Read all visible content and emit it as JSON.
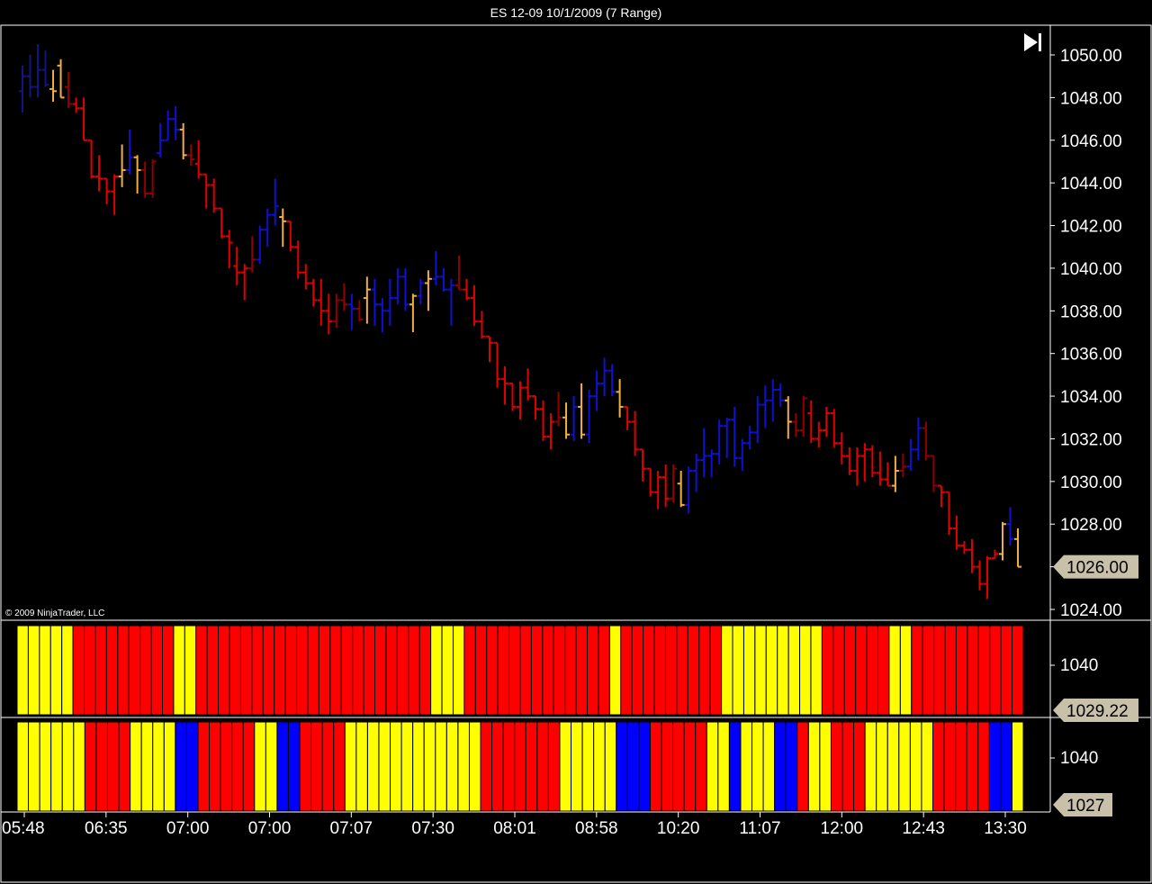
{
  "window": {
    "title": "ES 12-09  10/1/2009 (7 Range)"
  },
  "copyright": "© 2009 NinjaTrader, LLC",
  "icons": {
    "jump_to_end": "skip-to-end-icon"
  },
  "colors": {
    "background": "#000000",
    "up_bar": "#1010d0",
    "dark_up_bar": "#151580",
    "down_bar": "#e00000",
    "dark_down_bar": "#900000",
    "neutral_bar": "#f0b040",
    "histogram_yellow": "#ffff00",
    "histogram_red": "#ff0000",
    "histogram_blue": "#0000ff",
    "price_tag": "#c8c0a8"
  },
  "chart_data": [
    {
      "type": "ohlc",
      "panel": "price",
      "ylim": [
        1023.6,
        1051.2
      ],
      "y_ticks": [
        "1050.00",
        "1048.00",
        "1046.00",
        "1044.00",
        "1042.00",
        "1040.00",
        "1038.00",
        "1036.00",
        "1034.00",
        "1032.00",
        "1030.00",
        "1028.00",
        "1026.00",
        "1024.00"
      ],
      "y_tick_values": [
        1050,
        1048,
        1046,
        1044,
        1042,
        1040,
        1038,
        1036,
        1034,
        1032,
        1030,
        1028,
        1026,
        1024
      ],
      "last_price_label": "1026.00",
      "last_price": 1026.0,
      "bars": [
        {
          "o": 1048.3,
          "h": 1049.5,
          "l": 1047.3,
          "c": 1049.0,
          "col": "b"
        },
        {
          "o": 1049.0,
          "h": 1050.0,
          "l": 1048.0,
          "c": 1048.5,
          "col": "b"
        },
        {
          "o": 1048.5,
          "h": 1050.5,
          "l": 1048.0,
          "c": 1049.3,
          "col": "b"
        },
        {
          "o": 1049.3,
          "h": 1050.2,
          "l": 1048.5,
          "c": 1048.6,
          "col": "b"
        },
        {
          "o": 1048.4,
          "h": 1049.3,
          "l": 1047.8,
          "c": 1048.3,
          "col": "y"
        },
        {
          "o": 1049.5,
          "h": 1049.8,
          "l": 1048.0,
          "c": 1048.0,
          "col": "y"
        },
        {
          "o": 1048.5,
          "h": 1049.2,
          "l": 1047.5,
          "c": 1047.7,
          "col": "d"
        },
        {
          "o": 1047.7,
          "h": 1048.0,
          "l": 1047.3,
          "c": 1047.5,
          "col": "r"
        },
        {
          "o": 1047.5,
          "h": 1048.0,
          "l": 1046.0,
          "c": 1046.0,
          "col": "r"
        },
        {
          "o": 1046.0,
          "h": 1046.0,
          "l": 1044.2,
          "c": 1044.3,
          "col": "r"
        },
        {
          "o": 1044.3,
          "h": 1045.3,
          "l": 1043.6,
          "c": 1044.2,
          "col": "r"
        },
        {
          "o": 1044.2,
          "h": 1044.2,
          "l": 1043.0,
          "c": 1043.6,
          "col": "r"
        },
        {
          "o": 1043.6,
          "h": 1044.4,
          "l": 1042.5,
          "c": 1044.3,
          "col": "r"
        },
        {
          "o": 1044.3,
          "h": 1045.8,
          "l": 1043.8,
          "c": 1044.6,
          "col": "y"
        },
        {
          "o": 1044.6,
          "h": 1046.5,
          "l": 1044.4,
          "c": 1045.2,
          "col": "b"
        },
        {
          "o": 1045.2,
          "h": 1045.3,
          "l": 1043.5,
          "c": 1044.6,
          "col": "y"
        },
        {
          "o": 1044.6,
          "h": 1045.0,
          "l": 1043.3,
          "c": 1043.5,
          "col": "d"
        },
        {
          "o": 1043.5,
          "h": 1045.1,
          "l": 1043.3,
          "c": 1045.0,
          "col": "d"
        },
        {
          "o": 1045.4,
          "h": 1046.8,
          "l": 1045.2,
          "c": 1046.0,
          "col": "b"
        },
        {
          "o": 1046.0,
          "h": 1047.4,
          "l": 1046.0,
          "c": 1047.0,
          "col": "b"
        },
        {
          "o": 1047.0,
          "h": 1047.6,
          "l": 1046.0,
          "c": 1046.5,
          "col": "b"
        },
        {
          "o": 1046.5,
          "h": 1046.8,
          "l": 1045.1,
          "c": 1045.3,
          "col": "y"
        },
        {
          "o": 1045.3,
          "h": 1045.8,
          "l": 1044.8,
          "c": 1045.1,
          "col": "d"
        },
        {
          "o": 1044.9,
          "h": 1046.0,
          "l": 1044.2,
          "c": 1044.4,
          "col": "r"
        },
        {
          "o": 1044.4,
          "h": 1044.4,
          "l": 1042.8,
          "c": 1043.9,
          "col": "r"
        },
        {
          "o": 1043.9,
          "h": 1044.2,
          "l": 1042.6,
          "c": 1042.8,
          "col": "r"
        },
        {
          "o": 1042.8,
          "h": 1042.8,
          "l": 1041.4,
          "c": 1041.5,
          "col": "r"
        },
        {
          "o": 1041.5,
          "h": 1041.8,
          "l": 1040.0,
          "c": 1041.2,
          "col": "r"
        },
        {
          "o": 1040.1,
          "h": 1041.0,
          "l": 1039.2,
          "c": 1039.8,
          "col": "r"
        },
        {
          "o": 1039.8,
          "h": 1040.2,
          "l": 1038.5,
          "c": 1040.0,
          "col": "r"
        },
        {
          "o": 1040.0,
          "h": 1041.5,
          "l": 1039.8,
          "c": 1040.4,
          "col": "d"
        },
        {
          "o": 1040.4,
          "h": 1042.0,
          "l": 1040.2,
          "c": 1041.8,
          "col": "b"
        },
        {
          "o": 1041.8,
          "h": 1042.8,
          "l": 1041.0,
          "c": 1042.5,
          "col": "b"
        },
        {
          "o": 1042.5,
          "h": 1044.2,
          "l": 1042.0,
          "c": 1042.9,
          "col": "b"
        },
        {
          "o": 1042.4,
          "h": 1042.8,
          "l": 1041.0,
          "c": 1042.2,
          "col": "y"
        },
        {
          "o": 1042.2,
          "h": 1042.2,
          "l": 1040.8,
          "c": 1041.0,
          "col": "r"
        },
        {
          "o": 1041.0,
          "h": 1041.3,
          "l": 1039.5,
          "c": 1039.8,
          "col": "r"
        },
        {
          "o": 1039.8,
          "h": 1040.2,
          "l": 1039.0,
          "c": 1039.3,
          "col": "r"
        },
        {
          "o": 1039.3,
          "h": 1039.5,
          "l": 1038.2,
          "c": 1038.5,
          "col": "r"
        },
        {
          "o": 1038.5,
          "h": 1039.5,
          "l": 1037.3,
          "c": 1038.0,
          "col": "r"
        },
        {
          "o": 1038.0,
          "h": 1038.8,
          "l": 1036.9,
          "c": 1037.5,
          "col": "r"
        },
        {
          "o": 1037.5,
          "h": 1038.8,
          "l": 1037.2,
          "c": 1038.5,
          "col": "d"
        },
        {
          "o": 1038.5,
          "h": 1039.3,
          "l": 1038.0,
          "c": 1038.3,
          "col": "d"
        },
        {
          "o": 1038.3,
          "h": 1038.8,
          "l": 1037.1,
          "c": 1038.1,
          "col": "b"
        },
        {
          "o": 1038.1,
          "h": 1038.5,
          "l": 1037.5,
          "c": 1037.6,
          "col": "d"
        },
        {
          "o": 1038.6,
          "h": 1039.6,
          "l": 1037.4,
          "c": 1039.0,
          "col": "y"
        },
        {
          "o": 1039.0,
          "h": 1039.5,
          "l": 1037.3,
          "c": 1038.3,
          "col": "b"
        },
        {
          "o": 1038.3,
          "h": 1038.6,
          "l": 1037.0,
          "c": 1038.0,
          "col": "b"
        },
        {
          "o": 1038.0,
          "h": 1039.5,
          "l": 1037.3,
          "c": 1038.6,
          "col": "b"
        },
        {
          "o": 1038.6,
          "h": 1040.0,
          "l": 1038.3,
          "c": 1039.6,
          "col": "b"
        },
        {
          "o": 1039.6,
          "h": 1040.0,
          "l": 1038.0,
          "c": 1038.3,
          "col": "b"
        },
        {
          "o": 1038.3,
          "h": 1038.8,
          "l": 1037.0,
          "c": 1038.7,
          "col": "y"
        },
        {
          "o": 1038.7,
          "h": 1039.5,
          "l": 1038.3,
          "c": 1039.3,
          "col": "b"
        },
        {
          "o": 1039.3,
          "h": 1039.9,
          "l": 1038.0,
          "c": 1039.5,
          "col": "y"
        },
        {
          "o": 1039.5,
          "h": 1040.8,
          "l": 1039.2,
          "c": 1039.6,
          "col": "b"
        },
        {
          "o": 1039.6,
          "h": 1040.0,
          "l": 1038.9,
          "c": 1039.0,
          "col": "b"
        },
        {
          "o": 1039.0,
          "h": 1039.5,
          "l": 1037.3,
          "c": 1039.2,
          "col": "b"
        },
        {
          "o": 1039.2,
          "h": 1040.6,
          "l": 1039.0,
          "c": 1039.0,
          "col": "d"
        },
        {
          "o": 1039.0,
          "h": 1039.5,
          "l": 1038.5,
          "c": 1038.6,
          "col": "r"
        },
        {
          "o": 1038.6,
          "h": 1039.2,
          "l": 1037.3,
          "c": 1037.5,
          "col": "r"
        },
        {
          "o": 1037.5,
          "h": 1038.0,
          "l": 1036.7,
          "c": 1036.8,
          "col": "r"
        },
        {
          "o": 1036.8,
          "h": 1036.8,
          "l": 1035.6,
          "c": 1036.5,
          "col": "r"
        },
        {
          "o": 1036.5,
          "h": 1036.5,
          "l": 1034.4,
          "c": 1034.8,
          "col": "r"
        },
        {
          "o": 1034.8,
          "h": 1035.4,
          "l": 1033.6,
          "c": 1034.6,
          "col": "r"
        },
        {
          "o": 1034.6,
          "h": 1034.6,
          "l": 1033.3,
          "c": 1033.5,
          "col": "r"
        },
        {
          "o": 1033.5,
          "h": 1034.7,
          "l": 1032.9,
          "c": 1034.4,
          "col": "r"
        },
        {
          "o": 1034.4,
          "h": 1035.3,
          "l": 1033.8,
          "c": 1034.0,
          "col": "r"
        },
        {
          "o": 1034.0,
          "h": 1034.0,
          "l": 1032.9,
          "c": 1033.4,
          "col": "r"
        },
        {
          "o": 1033.4,
          "h": 1033.8,
          "l": 1031.9,
          "c": 1032.1,
          "col": "r"
        },
        {
          "o": 1032.1,
          "h": 1033.2,
          "l": 1031.5,
          "c": 1032.8,
          "col": "r"
        },
        {
          "o": 1032.8,
          "h": 1034.2,
          "l": 1032.6,
          "c": 1033.0,
          "col": "d"
        },
        {
          "o": 1033.0,
          "h": 1033.7,
          "l": 1032.0,
          "c": 1032.2,
          "col": "y"
        },
        {
          "o": 1032.2,
          "h": 1034.0,
          "l": 1031.9,
          "c": 1033.5,
          "col": "b"
        },
        {
          "o": 1033.5,
          "h": 1034.6,
          "l": 1032.0,
          "c": 1032.2,
          "col": "y"
        },
        {
          "o": 1032.2,
          "h": 1034.3,
          "l": 1031.8,
          "c": 1034.0,
          "col": "b"
        },
        {
          "o": 1034.0,
          "h": 1035.2,
          "l": 1033.3,
          "c": 1034.6,
          "col": "b"
        },
        {
          "o": 1034.6,
          "h": 1035.8,
          "l": 1034.0,
          "c": 1035.2,
          "col": "b"
        },
        {
          "o": 1035.2,
          "h": 1035.5,
          "l": 1034.0,
          "c": 1034.2,
          "col": "b"
        },
        {
          "o": 1034.2,
          "h": 1034.8,
          "l": 1033.0,
          "c": 1033.5,
          "col": "y"
        },
        {
          "o": 1033.5,
          "h": 1033.5,
          "l": 1032.4,
          "c": 1032.8,
          "col": "r"
        },
        {
          "o": 1032.8,
          "h": 1033.3,
          "l": 1031.2,
          "c": 1031.5,
          "col": "r"
        },
        {
          "o": 1031.5,
          "h": 1031.5,
          "l": 1030.0,
          "c": 1030.6,
          "col": "r"
        },
        {
          "o": 1030.6,
          "h": 1030.6,
          "l": 1029.3,
          "c": 1029.5,
          "col": "r"
        },
        {
          "o": 1029.5,
          "h": 1030.5,
          "l": 1028.7,
          "c": 1030.2,
          "col": "r"
        },
        {
          "o": 1030.2,
          "h": 1030.8,
          "l": 1028.8,
          "c": 1029.2,
          "col": "r"
        },
        {
          "o": 1029.2,
          "h": 1030.8,
          "l": 1029.0,
          "c": 1030.6,
          "col": "d"
        },
        {
          "o": 1029.9,
          "h": 1030.5,
          "l": 1028.8,
          "c": 1028.9,
          "col": "y"
        },
        {
          "o": 1028.9,
          "h": 1030.7,
          "l": 1028.5,
          "c": 1030.5,
          "col": "b"
        },
        {
          "o": 1030.5,
          "h": 1031.3,
          "l": 1029.5,
          "c": 1031.0,
          "col": "b"
        },
        {
          "o": 1031.0,
          "h": 1032.5,
          "l": 1030.2,
          "c": 1031.2,
          "col": "b"
        },
        {
          "o": 1031.2,
          "h": 1031.5,
          "l": 1030.2,
          "c": 1031.3,
          "col": "b"
        },
        {
          "o": 1031.3,
          "h": 1032.9,
          "l": 1030.8,
          "c": 1032.6,
          "col": "b"
        },
        {
          "o": 1032.6,
          "h": 1033.0,
          "l": 1031.1,
          "c": 1032.9,
          "col": "b"
        },
        {
          "o": 1032.9,
          "h": 1033.5,
          "l": 1030.7,
          "c": 1031.1,
          "col": "b"
        },
        {
          "o": 1031.1,
          "h": 1032.0,
          "l": 1030.5,
          "c": 1031.8,
          "col": "b"
        },
        {
          "o": 1031.8,
          "h": 1032.6,
          "l": 1031.5,
          "c": 1032.3,
          "col": "b"
        },
        {
          "o": 1032.3,
          "h": 1034.0,
          "l": 1031.8,
          "c": 1033.6,
          "col": "b"
        },
        {
          "o": 1033.6,
          "h": 1034.5,
          "l": 1032.5,
          "c": 1033.8,
          "col": "b"
        },
        {
          "o": 1033.8,
          "h": 1034.8,
          "l": 1032.8,
          "c": 1034.3,
          "col": "b"
        },
        {
          "o": 1034.3,
          "h": 1034.6,
          "l": 1033.5,
          "c": 1033.8,
          "col": "b"
        },
        {
          "o": 1033.8,
          "h": 1034.0,
          "l": 1032.0,
          "c": 1032.8,
          "col": "y"
        },
        {
          "o": 1032.8,
          "h": 1033.2,
          "l": 1032.1,
          "c": 1032.4,
          "col": "d"
        },
        {
          "o": 1032.4,
          "h": 1034.0,
          "l": 1032.1,
          "c": 1033.9,
          "col": "d"
        },
        {
          "o": 1033.2,
          "h": 1033.8,
          "l": 1031.8,
          "c": 1032.0,
          "col": "r"
        },
        {
          "o": 1032.0,
          "h": 1032.8,
          "l": 1031.6,
          "c": 1032.4,
          "col": "r"
        },
        {
          "o": 1032.4,
          "h": 1033.5,
          "l": 1032.1,
          "c": 1033.2,
          "col": "r"
        },
        {
          "o": 1033.2,
          "h": 1033.4,
          "l": 1031.6,
          "c": 1031.8,
          "col": "r"
        },
        {
          "o": 1031.8,
          "h": 1032.3,
          "l": 1030.8,
          "c": 1031.2,
          "col": "r"
        },
        {
          "o": 1031.2,
          "h": 1031.6,
          "l": 1030.3,
          "c": 1030.5,
          "col": "r"
        },
        {
          "o": 1030.5,
          "h": 1031.6,
          "l": 1029.8,
          "c": 1031.2,
          "col": "r"
        },
        {
          "o": 1031.2,
          "h": 1031.8,
          "l": 1030.0,
          "c": 1031.5,
          "col": "r"
        },
        {
          "o": 1031.5,
          "h": 1031.7,
          "l": 1030.2,
          "c": 1030.4,
          "col": "r"
        },
        {
          "o": 1030.4,
          "h": 1031.4,
          "l": 1029.8,
          "c": 1030.1,
          "col": "r"
        },
        {
          "o": 1030.1,
          "h": 1030.9,
          "l": 1029.8,
          "c": 1029.8,
          "col": "r"
        },
        {
          "o": 1029.8,
          "h": 1031.2,
          "l": 1029.5,
          "c": 1030.5,
          "col": "y"
        },
        {
          "o": 1030.5,
          "h": 1031.3,
          "l": 1030.2,
          "c": 1030.7,
          "col": "d"
        },
        {
          "o": 1030.7,
          "h": 1032.0,
          "l": 1030.5,
          "c": 1031.5,
          "col": "b"
        },
        {
          "o": 1031.5,
          "h": 1033.0,
          "l": 1031.0,
          "c": 1032.5,
          "col": "b"
        },
        {
          "o": 1032.5,
          "h": 1032.8,
          "l": 1031.0,
          "c": 1031.2,
          "col": "d"
        },
        {
          "o": 1031.2,
          "h": 1031.2,
          "l": 1029.5,
          "c": 1029.8,
          "col": "d"
        },
        {
          "o": 1029.8,
          "h": 1029.8,
          "l": 1028.8,
          "c": 1029.5,
          "col": "r"
        },
        {
          "o": 1029.5,
          "h": 1029.5,
          "l": 1027.5,
          "c": 1027.8,
          "col": "r"
        },
        {
          "o": 1027.8,
          "h": 1028.4,
          "l": 1026.8,
          "c": 1027.0,
          "col": "r"
        },
        {
          "o": 1027.0,
          "h": 1027.2,
          "l": 1026.6,
          "c": 1026.8,
          "col": "r"
        },
        {
          "o": 1026.8,
          "h": 1027.3,
          "l": 1025.7,
          "c": 1026.0,
          "col": "r"
        },
        {
          "o": 1026.0,
          "h": 1026.3,
          "l": 1024.9,
          "c": 1025.2,
          "col": "r"
        },
        {
          "o": 1025.2,
          "h": 1026.5,
          "l": 1024.5,
          "c": 1026.4,
          "col": "r"
        },
        {
          "o": 1026.4,
          "h": 1026.8,
          "l": 1026.4,
          "c": 1026.6,
          "col": "r"
        },
        {
          "o": 1026.6,
          "h": 1028.1,
          "l": 1026.3,
          "c": 1028.0,
          "col": "y"
        },
        {
          "o": 1028.0,
          "h": 1028.8,
          "l": 1027.0,
          "c": 1027.3,
          "col": "b"
        },
        {
          "o": 1027.3,
          "h": 1027.8,
          "l": 1026.0,
          "c": 1026.0,
          "col": "y"
        }
      ]
    },
    {
      "type": "histogram",
      "panel": "indicator-1",
      "y_tick": "1040",
      "last_value_label": "1029.22",
      "colors": "YYYYYRRRRRRRRRYYRRRRRRRRRRRRRRRRRRRRRYYYRRRRRRRRRRRRRYRRRRRRRRRYYYYYYYYYRRRRRRYYRRRRRRRRRR"
    },
    {
      "type": "histogram",
      "panel": "indicator-2",
      "y_tick": "1040",
      "last_value_label": "1027",
      "colors": "YYYYYYRRRRYYYYBBRRRRRYYBBRRRRYYYYYYYYYYYYRRRRRRRYYYYYBBBRRRRRYYBYYYBBRYYRRRYYYYYYRRRRRBBY"
    }
  ],
  "x_axis": {
    "labels": [
      "05:48",
      "06:35",
      "07:00",
      "07:00",
      "07:07",
      "07:30",
      "08:01",
      "08:58",
      "10:20",
      "11:07",
      "12:00",
      "12:43",
      "13:30"
    ]
  }
}
